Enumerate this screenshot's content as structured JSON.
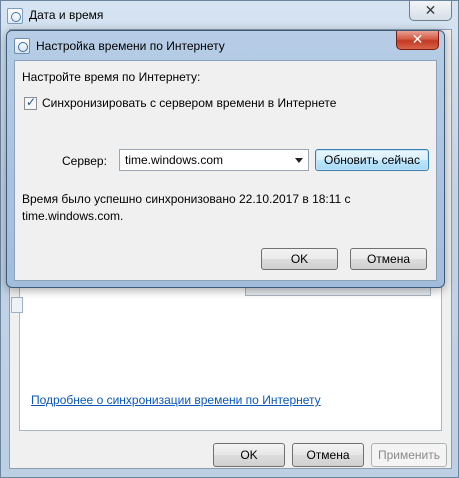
{
  "parent_window": {
    "title": "Дата и время",
    "close_glyph": "✕",
    "link_text": "Подробнее о синхронизации времени по Интернету",
    "buttons": {
      "ok": "OK",
      "cancel": "Отмена",
      "apply": "Применить"
    }
  },
  "dialog": {
    "title": "Настройка времени по Интернету",
    "close_glyph": "✕",
    "heading": "Настройте время по Интернету:",
    "sync_checkbox": {
      "label": "Синхронизировать с сервером времени в Интернете",
      "checked": true
    },
    "server_label": "Сервер:",
    "server_value": "time.windows.com",
    "update_button": "Обновить сейчас",
    "status_line1": "Время было успешно синхронизовано 22.10.2017 в 18:11 с",
    "status_line2": "time.windows.com.",
    "buttons": {
      "ok": "OK",
      "cancel": "Отмена"
    }
  },
  "colors": {
    "close_button_red": "#c23a22",
    "link_blue": "#0a56b8",
    "focus_button_blue": "#bee6fd"
  },
  "icons": {
    "window_icon": "clock-icon",
    "dropdown": "chevron-down-icon"
  }
}
